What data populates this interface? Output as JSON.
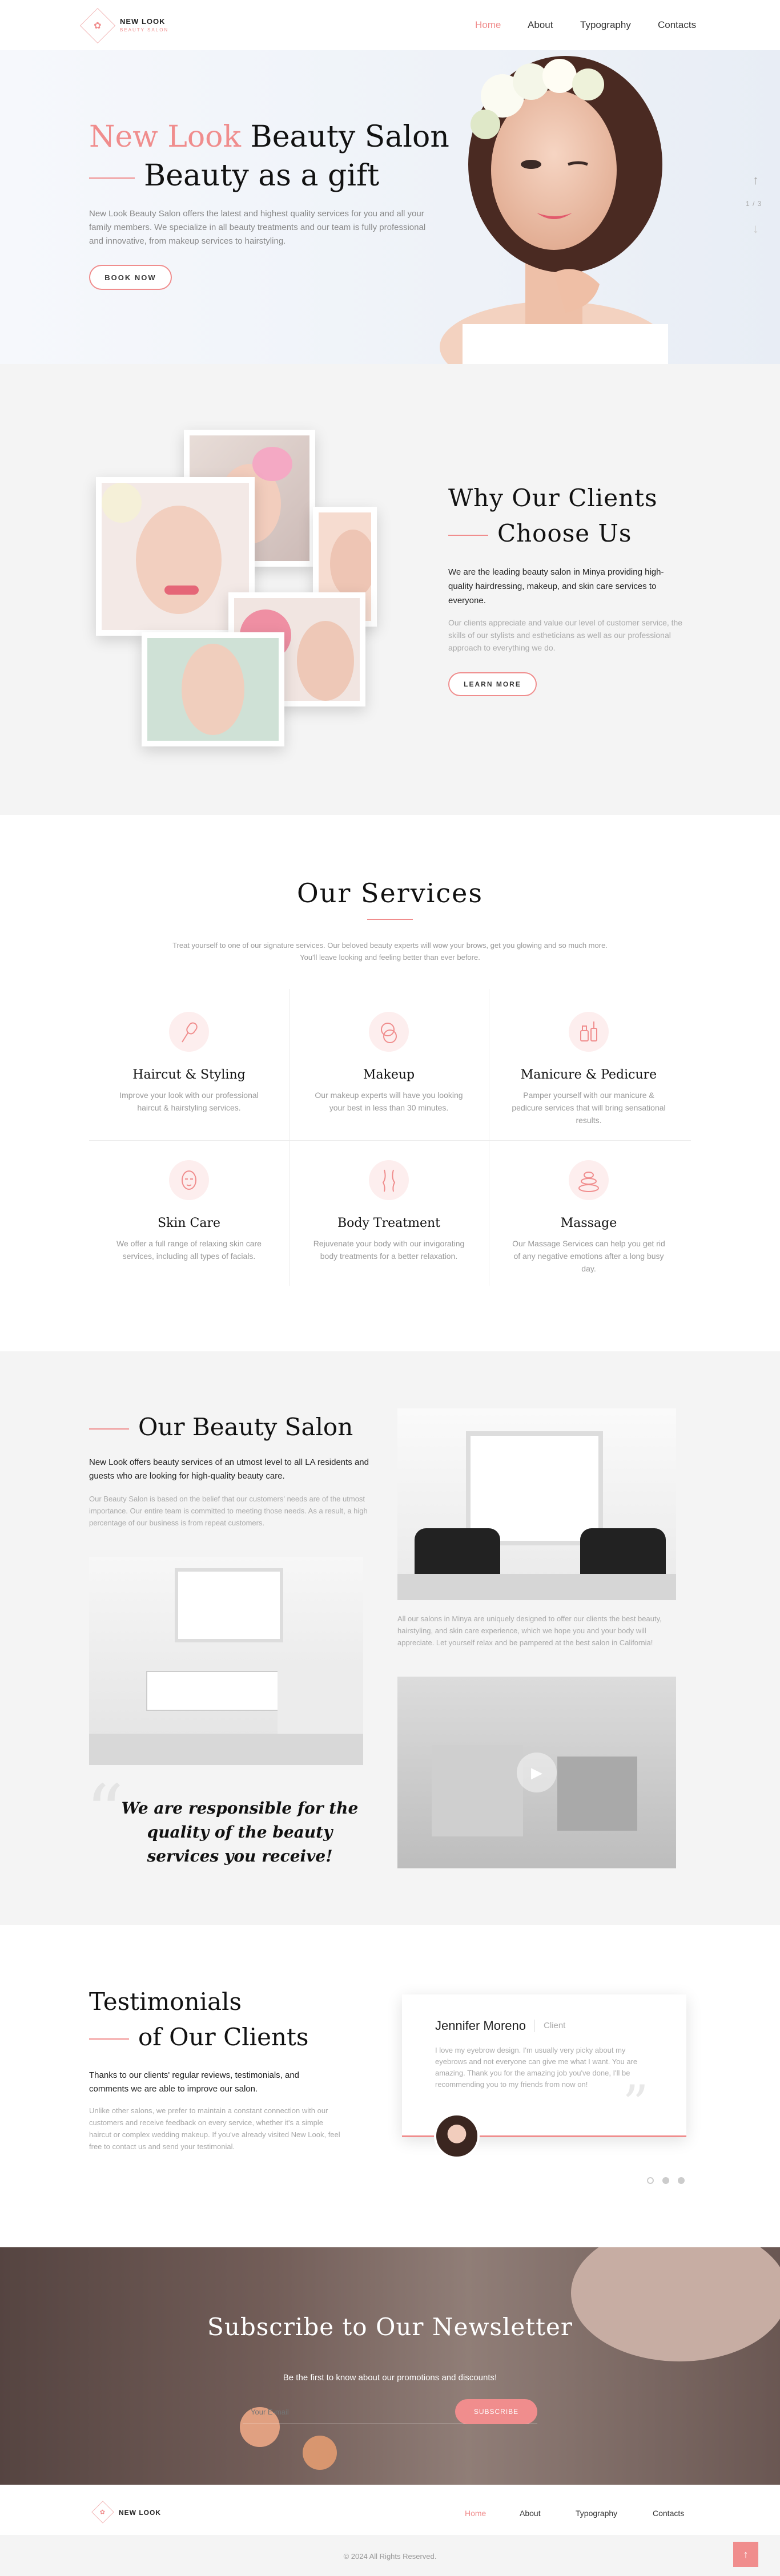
{
  "header": {
    "logo_main": "NEW LOOK",
    "logo_sub": "BEAUTY SALON",
    "nav": [
      "Home",
      "About",
      "Typography",
      "Contacts"
    ]
  },
  "hero": {
    "title_accent": "New Look",
    "title_rest": "Beauty Salon",
    "title_line2": "Beauty as a gift",
    "description": "New Look Beauty Salon offers the latest and highest quality services for you and all your family members. We specialize in all beauty treatments and our team is fully professional and innovative, from makeup services to hairstyling.",
    "button": "BOOK NOW",
    "slide_counter": "1 / 3"
  },
  "why": {
    "title_line1": "Why Our Clients",
    "title_line2": "Choose Us",
    "lead": "We are the leading beauty salon in Minya providing high-quality hairdressing, makeup, and skin care services to everyone.",
    "text": "Our clients appreciate and value our level of customer service, the skills of our stylists and estheticians as well as our professional approach to everything we do.",
    "button": "LEARN MORE"
  },
  "services": {
    "title": "Our Services",
    "intro": "Treat yourself to one of our signature services. Our beloved beauty experts will wow your brows, get you glowing and so much more. You'll leave looking and feeling better than ever before.",
    "items": [
      {
        "title": "Haircut & Styling",
        "desc": "Improve your look with our professional haircut & hairstyling services.",
        "icon": "hairbrush-icon"
      },
      {
        "title": "Makeup",
        "desc": "Our makeup experts will have you looking your best in less than 30 minutes.",
        "icon": "compact-mirror-icon"
      },
      {
        "title": "Manicure & Pedicure",
        "desc": "Pamper yourself with our manicure & pedicure services that will bring sensational results.",
        "icon": "nail-polish-icon"
      },
      {
        "title": "Skin Care",
        "desc": "We offer a full range of relaxing skin care services, including all types of facials.",
        "icon": "face-mask-icon"
      },
      {
        "title": "Body Treatment",
        "desc": "Rejuvenate your body with our invigorating body treatments for a better relaxation.",
        "icon": "body-silhouette-icon"
      },
      {
        "title": "Massage",
        "desc": "Our Massage Services can help you get rid of any negative emotions after a long busy day.",
        "icon": "spa-stones-icon"
      }
    ]
  },
  "salon": {
    "title": "Our Beauty Salon",
    "lead": "New Look offers beauty services of an utmost level to all LA residents and guests who are looking for high-quality beauty care.",
    "text": "Our Beauty Salon is based on the belief that our customers' needs are of the utmost importance. Our entire team is committed to meeting those needs. As a result, a high percentage of our business is from repeat customers.",
    "text2": "All our salons in Minya are uniquely designed to offer our clients the best beauty, hairstyling, and skin care experience, which we hope you and your body will appreciate. Let yourself relax and be pampered at the best salon in California!",
    "quote": "We are responsible for the quality of the beauty services you receive!"
  },
  "testimonials": {
    "title_line1": "Testimonials",
    "title_line2": "of Our Clients",
    "lead": "Thanks to our clients' regular reviews, testimonials, and comments we are able to improve our salon.",
    "text": "Unlike other salons, we prefer to maintain a constant connection with our customers and receive feedback on every service, whether it's a simple haircut or complex wedding makeup. If you've already visited New Look, feel free to contact us and send your testimonial.",
    "card": {
      "name": "Jennifer Moreno",
      "role": "Client",
      "text": "I love my eyebrow design. I'm usually very picky about my eyebrows and not everyone can give me what I want. You are amazing. Thank you for the amazing job you've done, I'll be recommending you to my friends from now on!"
    }
  },
  "newsletter": {
    "title": "Subscribe to Our Newsletter",
    "subtitle": "Be the first to know about our promotions and discounts!",
    "placeholder": "Your E-mail",
    "button": "SUBSCRIBE"
  },
  "footer": {
    "logo_main": "NEW LOOK",
    "nav": [
      "Home",
      "About",
      "Typography",
      "Contacts"
    ],
    "copyright": "© 2024 All Rights Reserved."
  },
  "colors": {
    "accent": "#f08d8d",
    "grey_bg": "#f4f4f4"
  }
}
